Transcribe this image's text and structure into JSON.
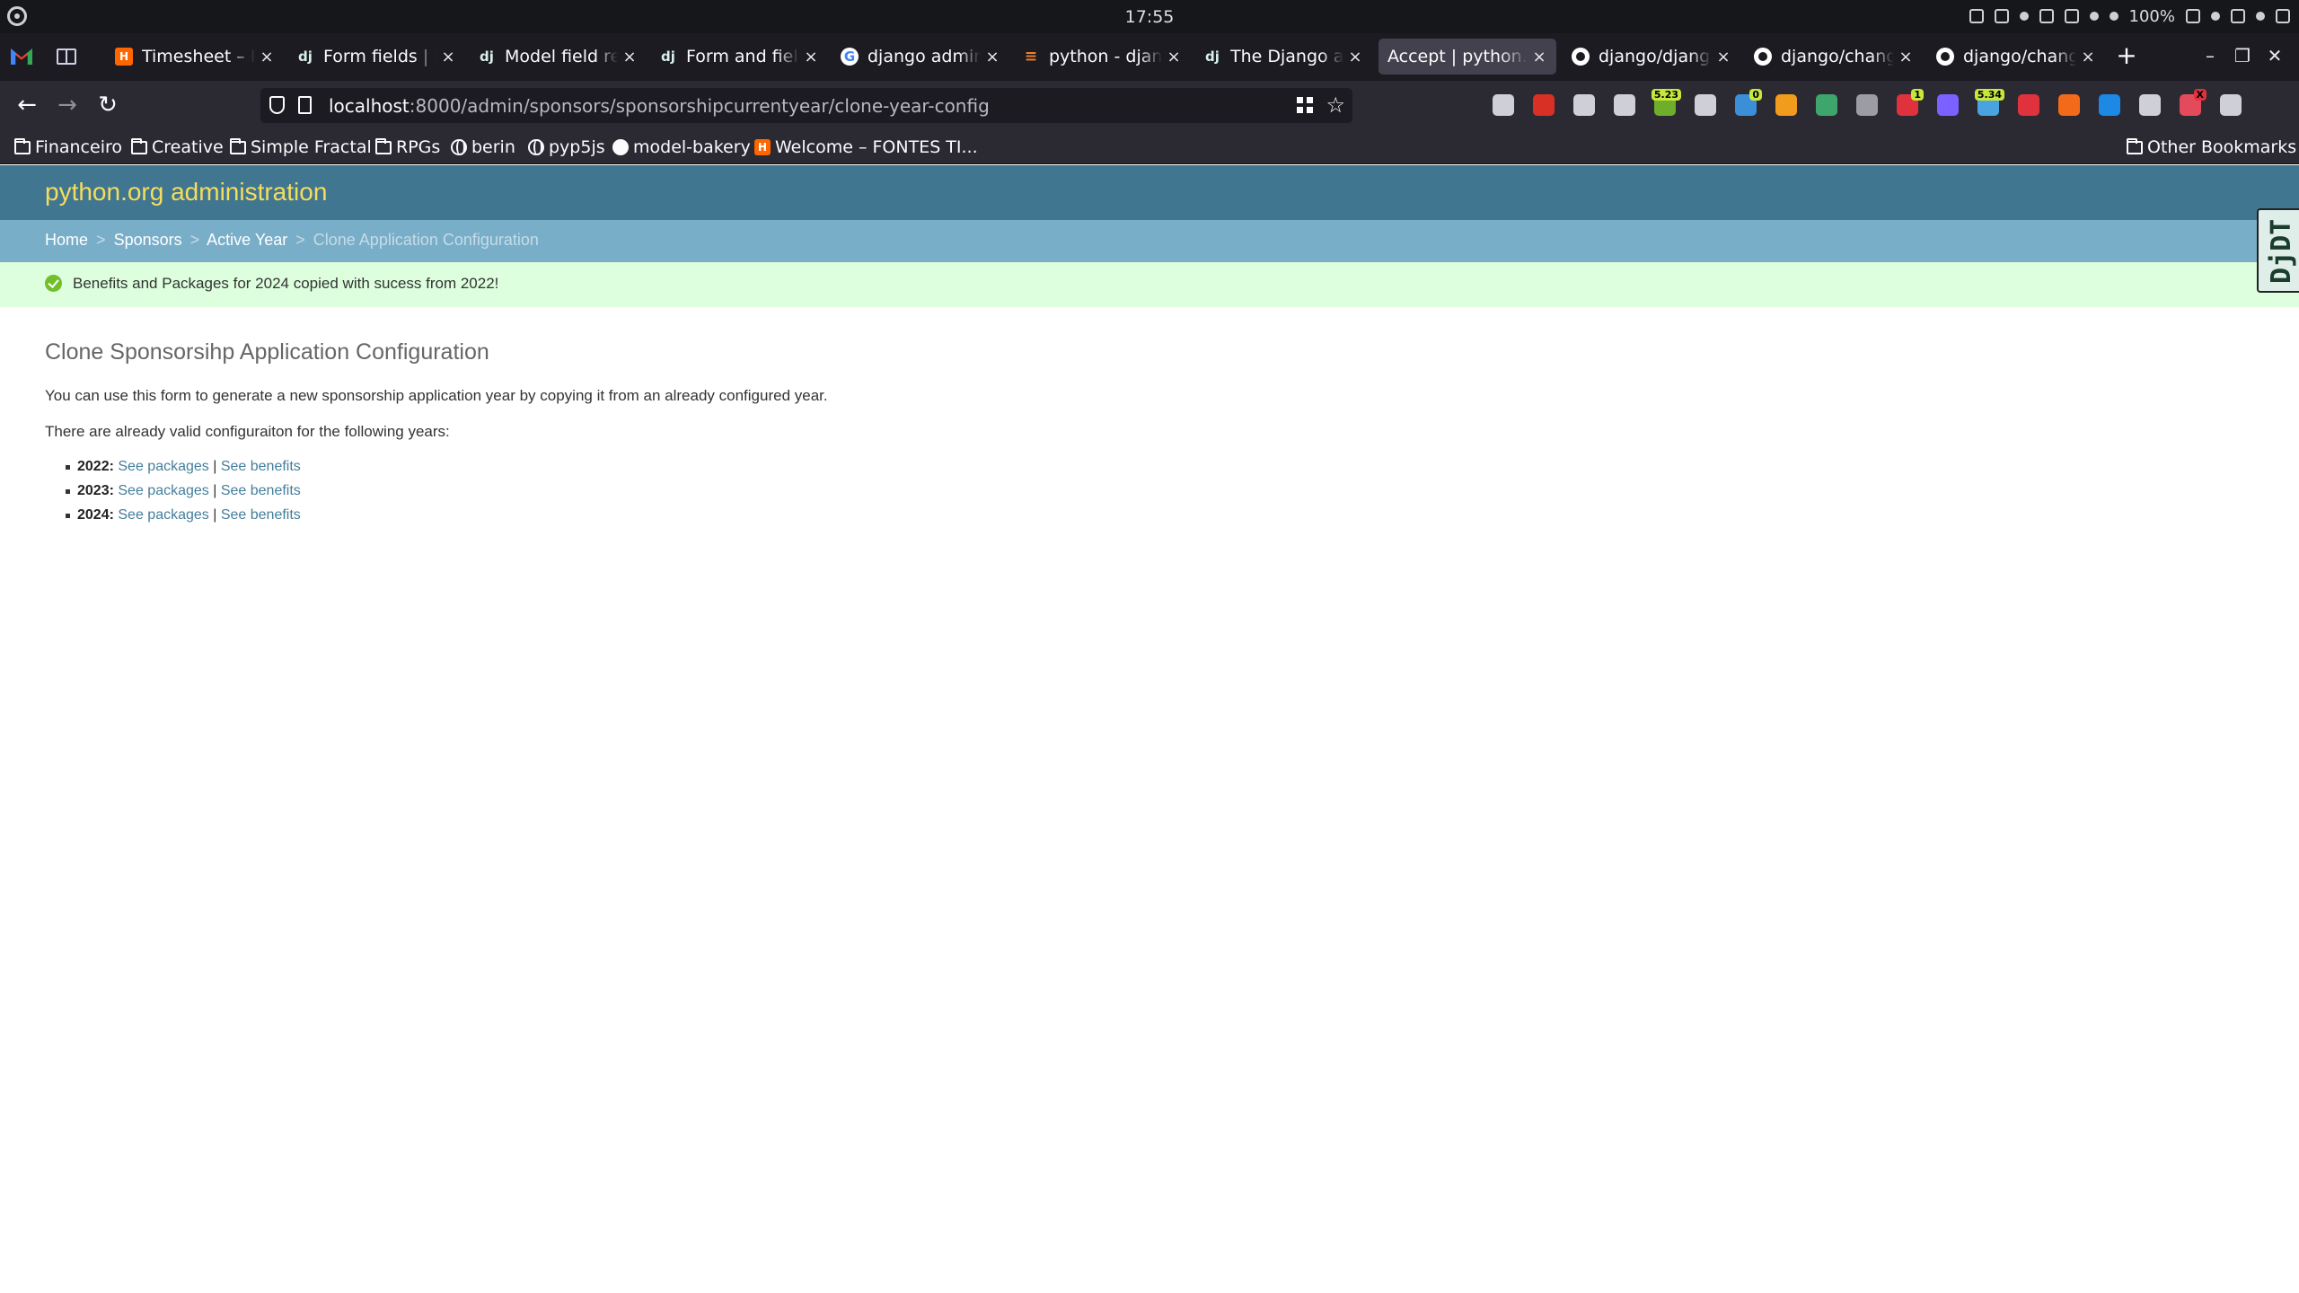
{
  "os": {
    "clock": "17:55",
    "battery": "100%"
  },
  "tabs": [
    {
      "title": "Timesheet – Py",
      "favicon": "h"
    },
    {
      "title": "Form fields | D",
      "favicon": "dj"
    },
    {
      "title": "Model field refe",
      "favicon": "dj"
    },
    {
      "title": "Form and field",
      "favicon": "dj"
    },
    {
      "title": "django admin c",
      "favicon": "g"
    },
    {
      "title": "python - djang",
      "favicon": "so"
    },
    {
      "title": "The Django adr",
      "favicon": "dj"
    },
    {
      "title": "Accept | python.o",
      "favicon": "none",
      "active": true
    },
    {
      "title": "django/django/",
      "favicon": "gh"
    },
    {
      "title": "django/change",
      "favicon": "gh"
    },
    {
      "title": "django/change",
      "favicon": "gh"
    }
  ],
  "nav": {
    "url_host": "localhost",
    "url_rest": ":8000/admin/sponsors/sponsorshipcurrentyear/clone-year-config"
  },
  "extensions": {
    "badges": [
      "5.23",
      "0",
      "1",
      "5.34",
      "X"
    ]
  },
  "bookmarks": [
    {
      "label": "Financeiro",
      "icon": "folder-icon"
    },
    {
      "label": "Creative",
      "icon": "folder-icon"
    },
    {
      "label": "Simple Fractal",
      "icon": "folder-icon"
    },
    {
      "label": "RPGs",
      "icon": "folder-icon"
    },
    {
      "label": "berin",
      "icon": "globe-icon"
    },
    {
      "label": "pyp5js",
      "icon": "globe-icon"
    },
    {
      "label": "model-bakery",
      "icon": "github-icon"
    },
    {
      "label": "Welcome – FONTES TI...",
      "icon": "h-icon"
    }
  ],
  "other_bookmarks": "Other Bookmarks",
  "admin": {
    "branding": "python.org administration",
    "breadcrumbs": {
      "home": "Home",
      "sponsors": "Sponsors",
      "active_year": "Active Year",
      "current": "Clone Application Configuration",
      "sep": ">"
    },
    "message": "Benefits and Packages for 2024 copied with sucess from 2022!",
    "djdt": "DjDT",
    "title": "Clone Sponsorsihp Application Configuration",
    "intro": "You can use this form to generate a new sponsorship application year by copying it from an already configured year.",
    "years_intro": "There are already valid configuraiton for the following years:",
    "years": [
      {
        "year": "2022:",
        "packages": "See packages",
        "benefits": "See benefits"
      },
      {
        "year": "2023:",
        "packages": "See packages",
        "benefits": "See benefits"
      },
      {
        "year": "2024:",
        "packages": "See packages",
        "benefits": "See benefits"
      }
    ],
    "link_sep": "|"
  },
  "colors": {
    "header_bg": "#417690",
    "branding": "#f5dd5d",
    "breadcrumb_bg": "#79aec8",
    "success_bg": "#ddffdd",
    "link": "#447e9b"
  }
}
